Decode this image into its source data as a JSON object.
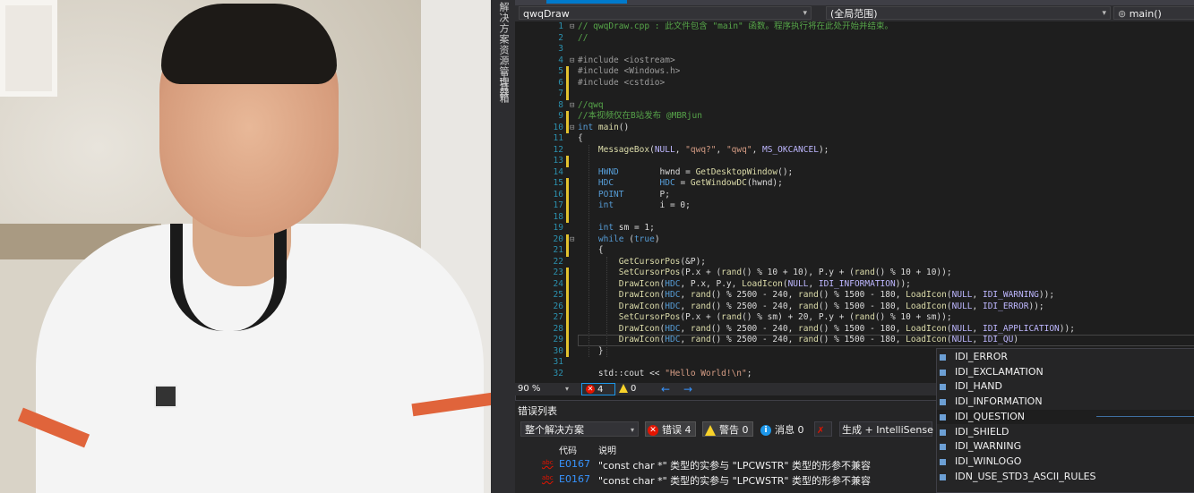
{
  "editor": {
    "tab_title": "qwqDraw",
    "scope_label": "(全局范围)",
    "member_label": "main()",
    "side_tabs": [
      "解决方案资源管理器",
      "工具箱"
    ],
    "lines": [
      {
        "n": "1",
        "code": "// qwqDraw.cpp : 此文件包含 \"main\" 函数。程序执行将在此处开始并结束。",
        "cls": "cm",
        "fold": "⊟"
      },
      {
        "n": "2",
        "code": "//",
        "cls": "cm",
        "fold": ""
      },
      {
        "n": "3",
        "code": "",
        "cls": "",
        "fold": ""
      },
      {
        "n": "4",
        "code": "#include <iostream>",
        "cls": "pp",
        "fold": "⊟"
      },
      {
        "n": "5",
        "code": "#include <Windows.h>",
        "cls": "pp",
        "fold": ""
      },
      {
        "n": "6",
        "code": "#include <cstdio>",
        "cls": "pp",
        "fold": ""
      },
      {
        "n": "7",
        "code": "",
        "cls": "",
        "fold": ""
      },
      {
        "n": "8",
        "code": "//qwq",
        "cls": "cm",
        "fold": "⊟"
      },
      {
        "n": "9",
        "code": "//本视频仅在B站发布 @MBRjun",
        "cls": "cm",
        "fold": ""
      },
      {
        "n": "10",
        "code": "int main()",
        "cls": "fn",
        "fold": "⊟"
      },
      {
        "n": "11",
        "code": "{",
        "cls": "",
        "fold": ""
      },
      {
        "n": "12",
        "code": "    MessageBox(NULL, \"qwq?\", \"qwq\", MS_OKCANCEL);",
        "cls": "",
        "fold": ""
      },
      {
        "n": "13",
        "code": "",
        "cls": "",
        "fold": ""
      },
      {
        "n": "14",
        "code": "    HWND        hwnd = GetDesktopWindow();",
        "cls": "",
        "fold": ""
      },
      {
        "n": "15",
        "code": "    HDC         HDC = GetWindowDC(hwnd);",
        "cls": "",
        "fold": ""
      },
      {
        "n": "16",
        "code": "    POINT       P;",
        "cls": "",
        "fold": ""
      },
      {
        "n": "17",
        "code": "    int         i = 0;",
        "cls": "",
        "fold": ""
      },
      {
        "n": "18",
        "code": "",
        "cls": "",
        "fold": ""
      },
      {
        "n": "19",
        "code": "    int sm = 1;",
        "cls": "",
        "fold": ""
      },
      {
        "n": "20",
        "code": "    while (true)",
        "cls": "",
        "fold": "⊟"
      },
      {
        "n": "21",
        "code": "    {",
        "cls": "",
        "fold": ""
      },
      {
        "n": "22",
        "code": "        GetCursorPos(&P);",
        "cls": "",
        "fold": ""
      },
      {
        "n": "23",
        "code": "        SetCursorPos(P.x + (rand() % 10 + 10), P.y + (rand() % 10 + 10));",
        "cls": "",
        "fold": ""
      },
      {
        "n": "24",
        "code": "        DrawIcon(HDC, P.x, P.y, LoadIcon(NULL, IDI_INFORMATION));",
        "cls": "",
        "fold": ""
      },
      {
        "n": "25",
        "code": "        DrawIcon(HDC, rand() % 2500 - 240, rand() % 1500 - 180, LoadIcon(NULL, IDI_WARNING));",
        "cls": "",
        "fold": ""
      },
      {
        "n": "26",
        "code": "        DrawIcon(HDC, rand() % 2500 - 240, rand() % 1500 - 180, LoadIcon(NULL, IDI_ERROR));",
        "cls": "",
        "fold": ""
      },
      {
        "n": "27",
        "code": "        SetCursorPos(P.x + (rand() % sm) + 20, P.y + (rand() % 10 + sm));",
        "cls": "",
        "fold": ""
      },
      {
        "n": "28",
        "code": "        DrawIcon(HDC, rand() % 2500 - 240, rand() % 1500 - 180, LoadIcon(NULL, IDI_APPLICATION));",
        "cls": "",
        "fold": ""
      },
      {
        "n": "29",
        "code": "        DrawIcon(HDC, rand() % 2500 - 240, rand() % 1500 - 180, LoadIcon(NULL, IDI_QU)",
        "cls": "",
        "fold": ""
      },
      {
        "n": "30",
        "code": "    }",
        "cls": "",
        "fold": ""
      },
      {
        "n": "31",
        "code": "",
        "cls": "",
        "fold": ""
      },
      {
        "n": "32",
        "code": "    std::cout << \"Hello World!\\n\";",
        "cls": "",
        "fold": ""
      }
    ]
  },
  "status": {
    "zoom": "90 %",
    "errors": "4",
    "warnings": "0",
    "back_arrow": "←",
    "fwd_arrow": "→"
  },
  "error_list": {
    "title": "错误列表",
    "scope": "整个解决方案",
    "errors_btn": "错误 4",
    "warnings_btn": "警告 0",
    "messages_btn": "消息 0",
    "build_filter": "生成 + IntelliSense",
    "col_code": "代码",
    "col_desc": "说明",
    "rows": [
      {
        "code": "E0167",
        "desc": "\"const char *\" 类型的实参与 \"LPCWSTR\" 类型的形参不兼容"
      },
      {
        "code": "E0167",
        "desc": "\"const char *\" 类型的实参与 \"LPCWSTR\" 类型的形参不兼容"
      }
    ]
  },
  "intellisense": {
    "items": [
      "IDI_ERROR",
      "IDI_EXCLAMATION",
      "IDI_HAND",
      "IDI_INFORMATION",
      "IDI_QUESTION",
      "IDI_SHIELD",
      "IDI_WARNING",
      "IDI_WINLOGO",
      "IDN_USE_STD3_ASCII_RULES"
    ],
    "selected_index": 4
  },
  "colors": {
    "keyword": "#569cd6",
    "comment": "#57a64a",
    "string": "#d69d85",
    "macro": "#beb7ff",
    "function": "#dcdcaa",
    "accent": "#007acc"
  }
}
